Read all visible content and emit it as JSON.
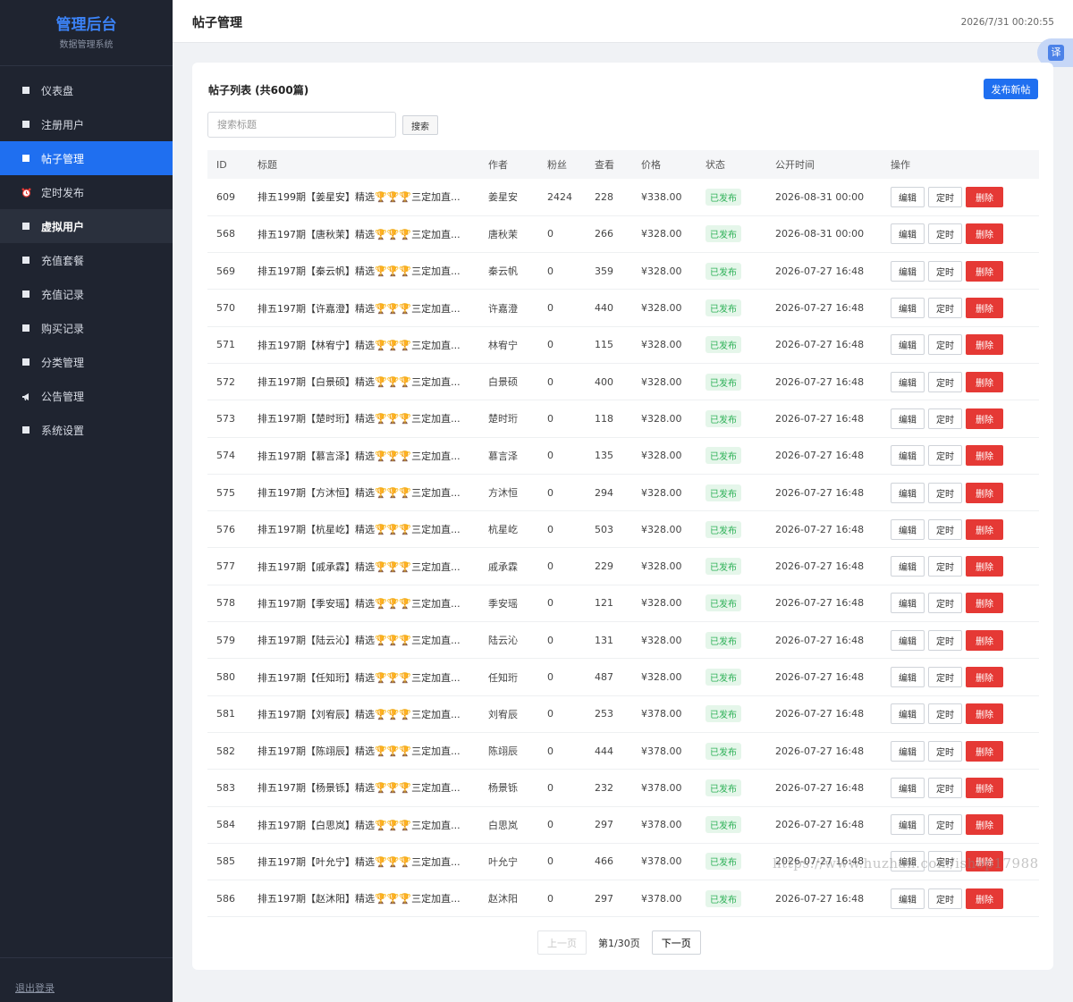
{
  "brand": {
    "title": "管理后台",
    "subtitle": "数据管理系统"
  },
  "sidebar": {
    "items": [
      {
        "label": "仪表盘"
      },
      {
        "label": "注册用户"
      },
      {
        "label": "帖子管理"
      },
      {
        "label": "定时发布"
      },
      {
        "label": "虚拟用户"
      },
      {
        "label": "充值套餐"
      },
      {
        "label": "充值记录"
      },
      {
        "label": "购买记录"
      },
      {
        "label": "分类管理"
      },
      {
        "label": "公告管理"
      },
      {
        "label": "系统设置"
      }
    ],
    "logout": "退出登录"
  },
  "header": {
    "title": "帖子管理",
    "datetime": "2026/7/31 00:20:55",
    "translate_label": "译"
  },
  "card": {
    "title": "帖子列表 (共600篇)",
    "new_post": "发布新帖",
    "search_placeholder": "搜索标题",
    "search_button": "搜索"
  },
  "table": {
    "headers": {
      "id": "ID",
      "title": "标题",
      "author": "作者",
      "fans": "粉丝",
      "views": "查看",
      "price": "价格",
      "status": "状态",
      "time": "公开时间",
      "ops": "操作"
    },
    "ops": {
      "edit": "编辑",
      "schedule": "定时",
      "delete": "删除"
    },
    "rows": [
      {
        "id": "609",
        "title": "排五199期【姜星安】精选🏆🏆🏆三定加直...",
        "author": "姜星安",
        "fans": "2424",
        "views": "228",
        "price": "¥338.00",
        "status": "已发布",
        "time": "2026-08-31 00:00"
      },
      {
        "id": "568",
        "title": "排五197期【唐秋茉】精选🏆🏆🏆三定加直...",
        "author": "唐秋茉",
        "fans": "0",
        "views": "266",
        "price": "¥328.00",
        "status": "已发布",
        "time": "2026-08-31 00:00"
      },
      {
        "id": "569",
        "title": "排五197期【秦云帆】精选🏆🏆🏆三定加直...",
        "author": "秦云帆",
        "fans": "0",
        "views": "359",
        "price": "¥328.00",
        "status": "已发布",
        "time": "2026-07-27 16:48"
      },
      {
        "id": "570",
        "title": "排五197期【许嘉澄】精选🏆🏆🏆三定加直...",
        "author": "许嘉澄",
        "fans": "0",
        "views": "440",
        "price": "¥328.00",
        "status": "已发布",
        "time": "2026-07-27 16:48"
      },
      {
        "id": "571",
        "title": "排五197期【林宥宁】精选🏆🏆🏆三定加直...",
        "author": "林宥宁",
        "fans": "0",
        "views": "115",
        "price": "¥328.00",
        "status": "已发布",
        "time": "2026-07-27 16:48"
      },
      {
        "id": "572",
        "title": "排五197期【白景硕】精选🏆🏆🏆三定加直...",
        "author": "白景硕",
        "fans": "0",
        "views": "400",
        "price": "¥328.00",
        "status": "已发布",
        "time": "2026-07-27 16:48"
      },
      {
        "id": "573",
        "title": "排五197期【楚时珩】精选🏆🏆🏆三定加直...",
        "author": "楚时珩",
        "fans": "0",
        "views": "118",
        "price": "¥328.00",
        "status": "已发布",
        "time": "2026-07-27 16:48"
      },
      {
        "id": "574",
        "title": "排五197期【慕言泽】精选🏆🏆🏆三定加直...",
        "author": "慕言泽",
        "fans": "0",
        "views": "135",
        "price": "¥328.00",
        "status": "已发布",
        "time": "2026-07-27 16:48"
      },
      {
        "id": "575",
        "title": "排五197期【方沐恒】精选🏆🏆🏆三定加直...",
        "author": "方沐恒",
        "fans": "0",
        "views": "294",
        "price": "¥328.00",
        "status": "已发布",
        "time": "2026-07-27 16:48"
      },
      {
        "id": "576",
        "title": "排五197期【杭星屹】精选🏆🏆🏆三定加直...",
        "author": "杭星屹",
        "fans": "0",
        "views": "503",
        "price": "¥328.00",
        "status": "已发布",
        "time": "2026-07-27 16:48"
      },
      {
        "id": "577",
        "title": "排五197期【戚承霖】精选🏆🏆🏆三定加直...",
        "author": "戚承霖",
        "fans": "0",
        "views": "229",
        "price": "¥328.00",
        "status": "已发布",
        "time": "2026-07-27 16:48"
      },
      {
        "id": "578",
        "title": "排五197期【季安瑶】精选🏆🏆🏆三定加直...",
        "author": "季安瑶",
        "fans": "0",
        "views": "121",
        "price": "¥328.00",
        "status": "已发布",
        "time": "2026-07-27 16:48"
      },
      {
        "id": "579",
        "title": "排五197期【陆云沁】精选🏆🏆🏆三定加直...",
        "author": "陆云沁",
        "fans": "0",
        "views": "131",
        "price": "¥328.00",
        "status": "已发布",
        "time": "2026-07-27 16:48"
      },
      {
        "id": "580",
        "title": "排五197期【任知珩】精选🏆🏆🏆三定加直...",
        "author": "任知珩",
        "fans": "0",
        "views": "487",
        "price": "¥328.00",
        "status": "已发布",
        "time": "2026-07-27 16:48"
      },
      {
        "id": "581",
        "title": "排五197期【刘宥辰】精选🏆🏆🏆三定加直...",
        "author": "刘宥辰",
        "fans": "0",
        "views": "253",
        "price": "¥378.00",
        "status": "已发布",
        "time": "2026-07-27 16:48"
      },
      {
        "id": "582",
        "title": "排五197期【陈翊辰】精选🏆🏆🏆三定加直...",
        "author": "陈翊辰",
        "fans": "0",
        "views": "444",
        "price": "¥378.00",
        "status": "已发布",
        "time": "2026-07-27 16:48"
      },
      {
        "id": "583",
        "title": "排五197期【杨景铄】精选🏆🏆🏆三定加直...",
        "author": "杨景铄",
        "fans": "0",
        "views": "232",
        "price": "¥378.00",
        "status": "已发布",
        "time": "2026-07-27 16:48"
      },
      {
        "id": "584",
        "title": "排五197期【白思岚】精选🏆🏆🏆三定加直...",
        "author": "白思岚",
        "fans": "0",
        "views": "297",
        "price": "¥378.00",
        "status": "已发布",
        "time": "2026-07-27 16:48"
      },
      {
        "id": "585",
        "title": "排五197期【叶允宁】精选🏆🏆🏆三定加直...",
        "author": "叶允宁",
        "fans": "0",
        "views": "466",
        "price": "¥378.00",
        "status": "已发布",
        "time": "2026-07-27 16:48"
      },
      {
        "id": "586",
        "title": "排五197期【赵沐阳】精选🏆🏆🏆三定加直...",
        "author": "赵沐阳",
        "fans": "0",
        "views": "297",
        "price": "¥378.00",
        "status": "已发布",
        "time": "2026-07-27 16:48"
      }
    ]
  },
  "pagination": {
    "prev": "上一页",
    "info": "第1/30页",
    "next": "下一页"
  },
  "watermark": "https://www.huzhan.com/ishop17988",
  "colors": {
    "sidebar_bg": "#1f2430",
    "accent": "#1f6ff0",
    "danger": "#e53935",
    "success": "#2fb158"
  }
}
